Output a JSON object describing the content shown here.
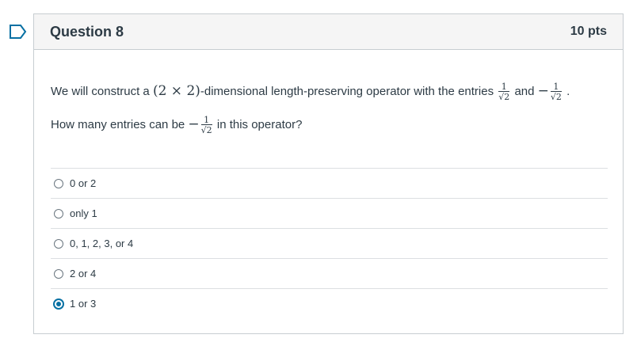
{
  "question": {
    "title": "Question 8",
    "points": "10 pts",
    "text_part1": "We will construct a ",
    "math_dim": "(2 × 2)",
    "text_part2": "-dimensional length-preserving operator with the entries ",
    "frac_num": "1",
    "frac_den": "√2",
    "and_text": " and ",
    "minus": "−",
    "period": " .",
    "line2_part1": "How many entries can be ",
    "line2_part2": " in this operator?"
  },
  "answers": [
    {
      "label": "0 or 2",
      "selected": false
    },
    {
      "label": "only 1",
      "selected": false
    },
    {
      "label": "0, 1, 2, 3, or 4",
      "selected": false
    },
    {
      "label": "2 or 4",
      "selected": false
    },
    {
      "label": "1 or 3",
      "selected": true
    }
  ],
  "colors": {
    "accent": "#0770a3",
    "header_bg": "#f5f5f5",
    "border": "#c7cdd1",
    "text": "#2d3b45"
  }
}
